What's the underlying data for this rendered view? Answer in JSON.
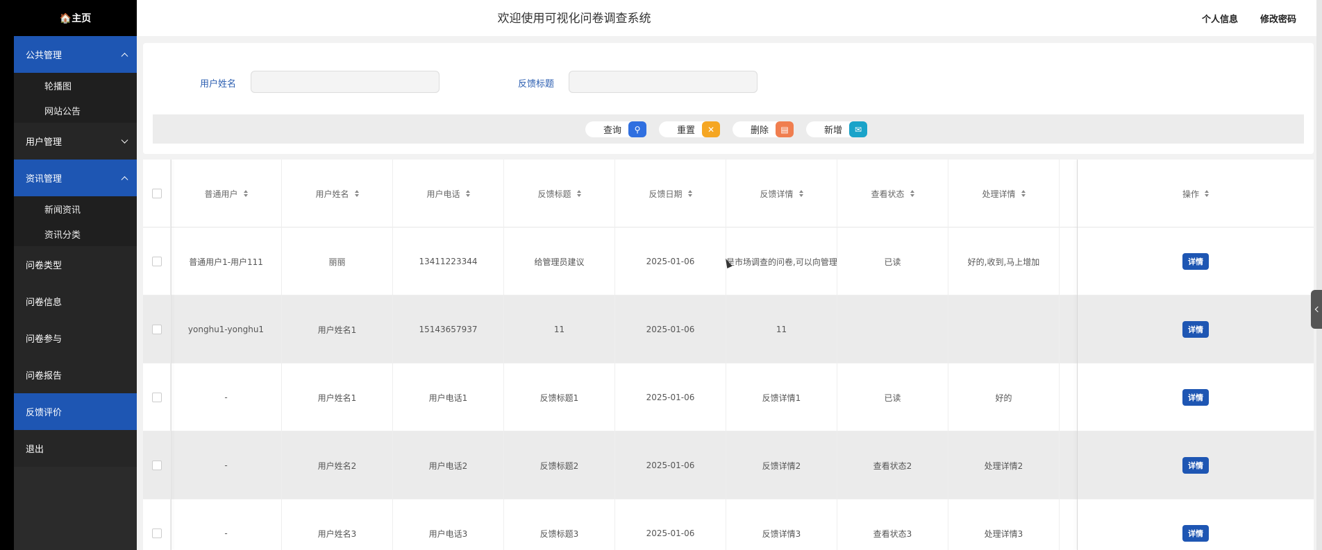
{
  "sidebar": {
    "home": "🏠主页",
    "groups": [
      {
        "label": "公共管理",
        "items": [
          "轮播图",
          "网站公告"
        ]
      },
      {
        "label": "用户管理"
      },
      {
        "label": "资讯管理",
        "items": [
          "新闻资讯",
          "资讯分类"
        ]
      }
    ],
    "items": [
      "问卷类型",
      "问卷信息",
      "问卷参与",
      "问卷报告",
      "反馈评价",
      "退出"
    ]
  },
  "header": {
    "title": "欢迎使用可视化问卷调查系统",
    "profile": "个人信息",
    "change_password": "修改密码"
  },
  "search": {
    "username_label": "用户姓名",
    "title_label": "反馈标题",
    "username_value": "",
    "title_value": ""
  },
  "actions": {
    "query": "查询",
    "reset": "重置",
    "delete": "删除",
    "add": "新增"
  },
  "table": {
    "headers": [
      "普通用户",
      "用户姓名",
      "用户电话",
      "反馈标题",
      "反馈日期",
      "反馈详情",
      "查看状态",
      "处理详情",
      "操作"
    ],
    "detail_label": "详情",
    "rows": [
      [
        "普通用户1-用户111",
        "丽丽",
        "13411223344",
        "给管理员建议",
        "2025-01-06",
        "是市场调查的问卷,可以向管理员",
        "已读",
        "好的,收到,马上增加"
      ],
      [
        "yonghu1-yonghu1",
        "用户姓名1",
        "15143657937",
        "11",
        "2025-01-06",
        "11",
        "",
        ""
      ],
      [
        "-",
        "用户姓名1",
        "用户电话1",
        "反馈标题1",
        "2025-01-06",
        "反馈详情1",
        "已读",
        "好的"
      ],
      [
        "-",
        "用户姓名2",
        "用户电话2",
        "反馈标题2",
        "2025-01-06",
        "反馈详情2",
        "查看状态2",
        "处理详情2"
      ],
      [
        "-",
        "用户姓名3",
        "用户电话3",
        "反馈标题3",
        "2025-01-06",
        "反馈详情3",
        "查看状态3",
        "处理详情3"
      ]
    ]
  },
  "colors": {
    "accent": "#1e56b3",
    "query_icon": "#2f6fe0",
    "reset_icon": "#f5a623",
    "delete_icon": "#f07e4f",
    "add_icon": "#1aa3c9"
  }
}
